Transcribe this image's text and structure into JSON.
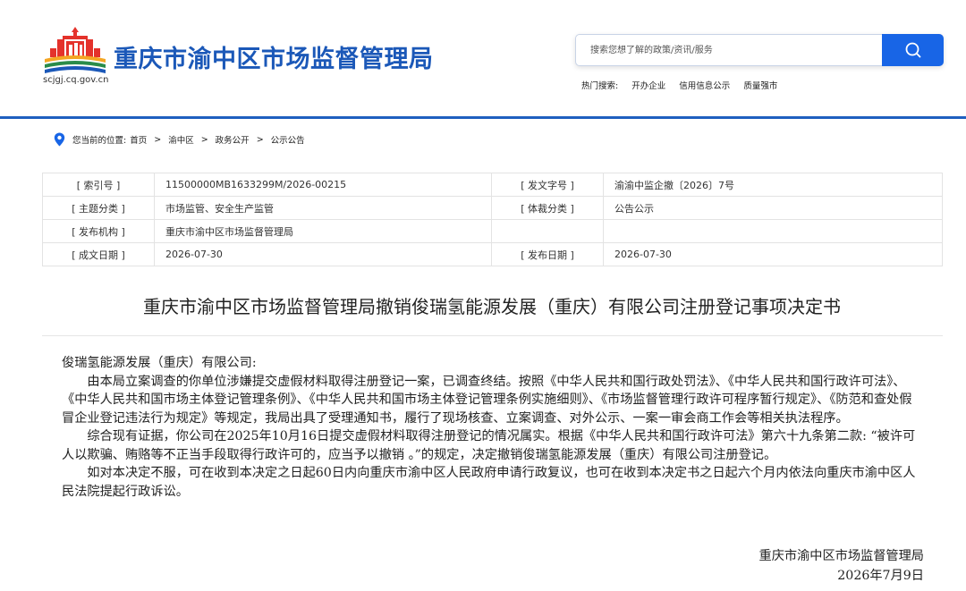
{
  "site": {
    "name": "重庆市渝中区市场监督管理局",
    "url": "scjgj.cq.gov.cn"
  },
  "search": {
    "placeholder": "搜索您想了解的政策/资讯/服务",
    "icon": "search-icon"
  },
  "hot_search": {
    "label": "热门搜索:",
    "items": [
      "开办企业",
      "信用信息公示",
      "质量强市"
    ]
  },
  "breadcrumb": {
    "label": "您当前的位置:",
    "items": [
      "首页",
      "渝中区",
      "政务公开",
      "公示公告"
    ],
    "separator": ">"
  },
  "meta": {
    "rows": [
      {
        "l1": "[ 索引号 ]",
        "v1": "11500000MB1633299M/2026-00215",
        "l2": "[ 发文字号 ]",
        "v2": "渝渝中监企撤〔2026〕7号"
      },
      {
        "l1": "[ 主题分类 ]",
        "v1": "市场监管、安全生产监管",
        "l2": "[ 体裁分类 ]",
        "v2": "公告公示"
      },
      {
        "l1": "[ 发布机构 ]",
        "v1": "重庆市渝中区市场监督管理局",
        "l2": "",
        "v2": ""
      },
      {
        "l1": "[ 成文日期 ]",
        "v1": "2026-07-30",
        "l2": "[ 发布日期 ]",
        "v2": "2026-07-30"
      }
    ]
  },
  "doc": {
    "title": "重庆市渝中区市场监督管理局撤销俊瑞氢能源发展（重庆）有限公司注册登记事项决定书",
    "salutation": "俊瑞氢能源发展（重庆）有限公司:",
    "p1": "由本局立案调查的你单位涉嫌提交虚假材料取得注册登记一案，已调查终结。按照《中华人民共和国行政处罚法》、《中华人民共和国行政许可法》、《中华人民共和国市场主体登记管理条例》、《中华人民共和国市场主体登记管理条例实施细则》、《市场监督管理行政许可程序暂行规定》、《防范和查处假冒企业登记违法行为规定》等规定，我局出具了受理通知书，履行了现场核查、立案调查、对外公示、一案一审会商工作会等相关执法程序。",
    "p2": "综合现有证据，你公司在2025年10月16日提交虚假材料取得注册登记的情况属实。根据《中华人民共和国行政许可法》第六十九条第二款: “被许可人以欺骗、贿赂等不正当手段取得行政许可的，应当予以撤销 。”的规定，决定撤销俊瑞氢能源发展（重庆）有限公司注册登记。",
    "p3": "如对本决定不服，可在收到本决定之日起60日内向重庆市渝中区人民政府申请行政复议，也可在收到本决定书之日起六个月内依法向重庆市渝中区人民法院提起行政诉讼。",
    "sign_org": "重庆市渝中区市场监督管理局",
    "sign_date": "2026年7月9日"
  },
  "colors": {
    "brand_blue": "#1b58b8",
    "search_button": "#1865e6",
    "header_line": "#1f5fbf"
  }
}
